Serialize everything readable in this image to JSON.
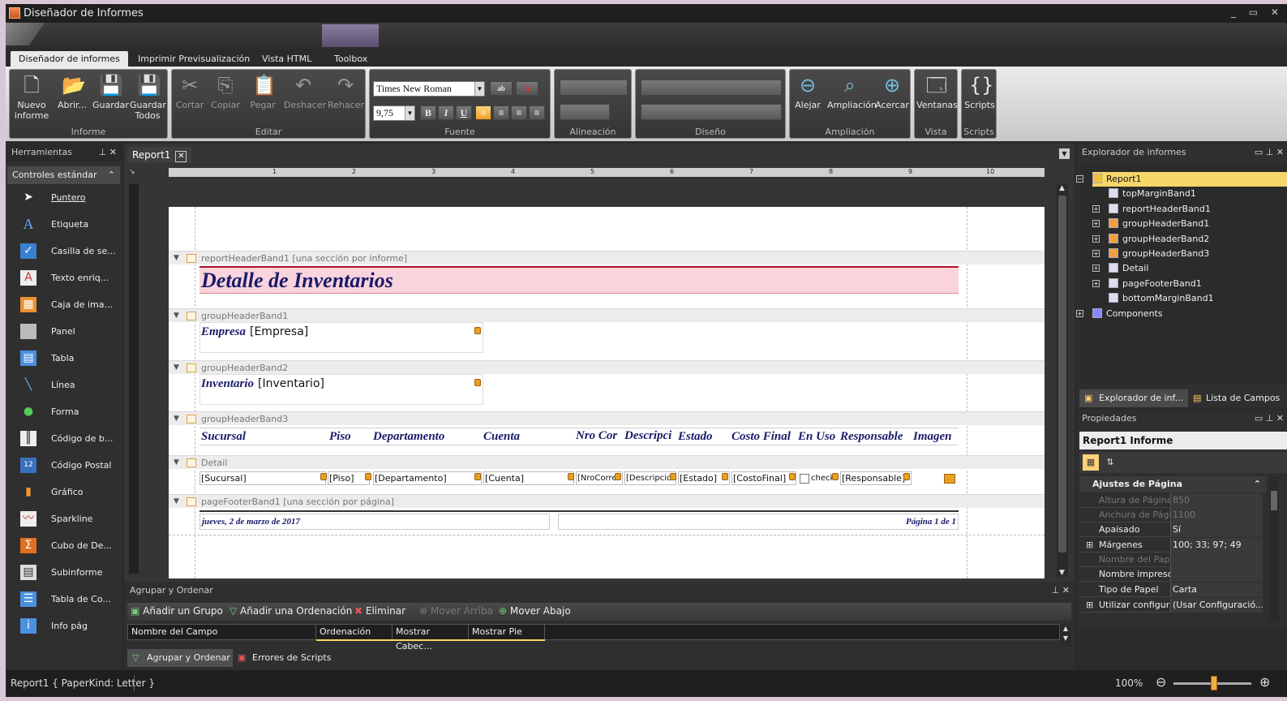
{
  "window": {
    "title": "Diseñador de Informes",
    "controls": "_ ▭ ✕"
  },
  "tabs": [
    "Diseñador de informes",
    "Imprimir Previsualización",
    "Vista HTML",
    "Toolbox"
  ],
  "ribbon": {
    "informe": {
      "label": "Informe",
      "buttons": [
        "Nuevo informe",
        "Abrir...",
        "Guardar",
        "Guardar Todos"
      ]
    },
    "editar": {
      "label": "Editar",
      "buttons": [
        "Cortar",
        "Copiar",
        "Pegar",
        "Deshacer",
        "Rehacer"
      ]
    },
    "fuente": {
      "label": "Fuente",
      "font_name": "Times New Roman",
      "font_size": "9,75",
      "bold": "B",
      "italic": "I",
      "underline": "U"
    },
    "alineacion": {
      "label": "Alineación"
    },
    "diseno": {
      "label": "Diseño"
    },
    "ampliacion": {
      "label": "Ampliación",
      "buttons": [
        "Alejar",
        "Ampliación",
        "Acercar"
      ]
    },
    "vista": {
      "label": "Vista",
      "button": "Ventanas"
    },
    "scripts": {
      "label": "Scripts",
      "button": "Scripts"
    }
  },
  "toolbox": {
    "title": "Herramientas",
    "group": "Controles estándar",
    "items": [
      "Puntero",
      "Etiqueta",
      "Casilla de se...",
      "Texto enriq...",
      "Caja de ima...",
      "Panel",
      "Tabla",
      "Línea",
      "Forma",
      "Código de b...",
      "Código Postal",
      "Gráfico",
      "Sparkline",
      "Cubo de De...",
      "Subinforme",
      "Tabla de Co...",
      "Info pág"
    ]
  },
  "document": {
    "tab": "Report1",
    "close": "✕"
  },
  "ruler": {
    "marks": [
      "1",
      "2",
      "3",
      "4",
      "5",
      "6",
      "7",
      "8",
      "9",
      "10"
    ]
  },
  "report": {
    "bands": {
      "reportHeader": "reportHeaderBand1 [una sección por informe]",
      "group1": "groupHeaderBand1",
      "group2": "groupHeaderBand2",
      "group3": "groupHeaderBand3",
      "detail": "Detail",
      "pageFooter": "pageFooterBand1 [una sección por página]"
    },
    "title": "Detalle de Inventarios",
    "empresa_label": "Empresa",
    "empresa_field": "[Empresa]",
    "inventario_label": "Inventario",
    "inventario_field": "[Inventario]",
    "columns": [
      "Sucursal",
      "Piso",
      "Departamento",
      "Cuenta",
      "Nro Cor",
      "Descripci",
      "Estado",
      "Costo Final",
      "En Uso",
      "Responsable",
      "Imagen"
    ],
    "fields": [
      "[Sucursal]",
      "[Piso]",
      "[Departamento]",
      "[Cuenta]",
      "[NroCorre",
      "[Descripcio",
      "[Estado]",
      "[CostoFinal]",
      "check",
      "[Responsable]"
    ],
    "footer_date": "jueves, 2 de marzo de 2017",
    "footer_page": "Página 1 de 1"
  },
  "group_order": {
    "title": "Agrupar y Ordenar",
    "buttons": [
      "Añadir un Grupo",
      "Añadir una Ordenación",
      "Eliminar",
      "Mover Arriba",
      "Mover Abajo"
    ],
    "columns": [
      "Nombre del Campo",
      "Ordenación",
      "Mostrar Cabec...",
      "Mostrar Pie"
    ],
    "tabs": [
      "Agrupar y Ordenar",
      "Errores de Scripts"
    ]
  },
  "explorer": {
    "title": "Explorador de informes",
    "nodes": [
      "Report1",
      "topMarginBand1",
      "reportHeaderBand1",
      "groupHeaderBand1",
      "groupHeaderBand2",
      "groupHeaderBand3",
      "Detail",
      "pageFooterBand1",
      "bottomMarginBand1",
      "Components"
    ],
    "tabs": [
      "Explorador de inf...",
      "Lista de Campos"
    ]
  },
  "properties": {
    "title": "Propiedades",
    "object": "Report1  Informe",
    "category": "Ajustes de Página",
    "rows": [
      {
        "name": "Altura de Página",
        "value": "850"
      },
      {
        "name": "Anchura de Página",
        "value": "1100"
      },
      {
        "name": "Apaisado",
        "value": "Sí"
      },
      {
        "name": "Márgenes",
        "value": "100; 33; 97; 49"
      },
      {
        "name": "Nombre del Papel",
        "value": ""
      },
      {
        "name": "Nombre impresor",
        "value": ""
      },
      {
        "name": "Tipo de Papel",
        "value": "Carta"
      },
      {
        "name": "Utilizar configura",
        "value": "(Usar Configuració..."
      }
    ]
  },
  "status": {
    "text": "Report1 { PaperKind: Letter }",
    "zoom": "100%"
  }
}
